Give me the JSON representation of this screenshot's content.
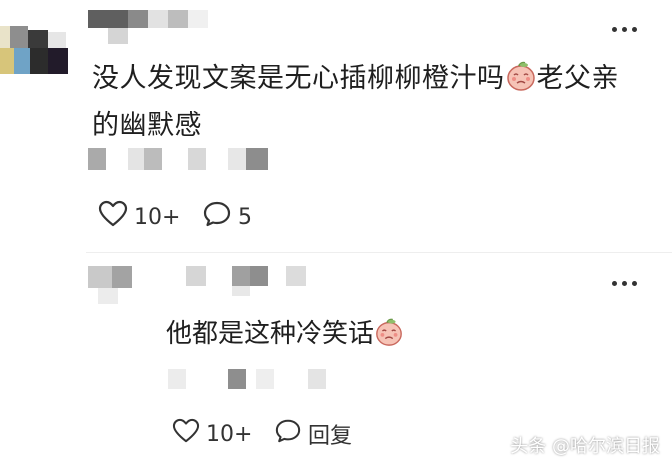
{
  "comment": {
    "text": "没人发现文案是无心插柳柳橙汁吗",
    "text_after_emoji": "老父亲",
    "text_line2": "的幽默感",
    "emoji": "peach-cry-emoji",
    "likes": "10+",
    "replies": "5"
  },
  "reply": {
    "text": "他都是这种冷笑话",
    "emoji": "peach-cry-emoji",
    "likes": "10+",
    "reply_label": "回复"
  },
  "watermark": "头条 @哈尔滨日报"
}
